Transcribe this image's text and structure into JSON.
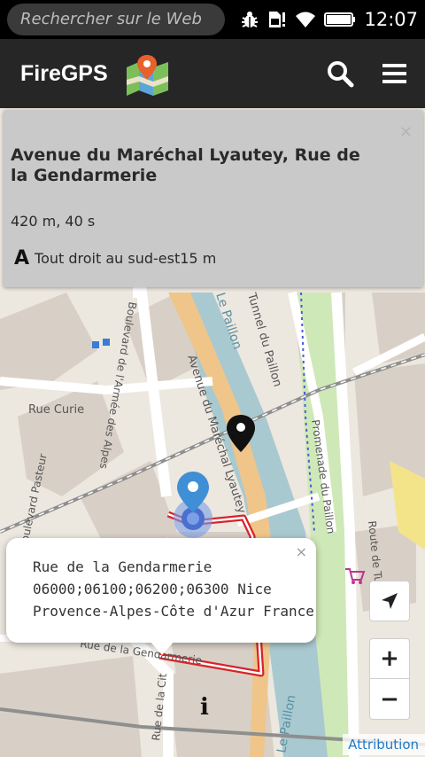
{
  "status_bar": {
    "search_placeholder": "Rechercher sur le Web",
    "time": "12:07",
    "icons": [
      "bug-icon",
      "sim-alert-icon",
      "wifi-icon",
      "battery-icon"
    ]
  },
  "app_bar": {
    "title": "FireGPS",
    "logo_icon": "map-pin-logo-icon",
    "search_icon": "search-icon",
    "menu_icon": "hamburger-menu-icon"
  },
  "route_panel": {
    "close": "×",
    "address": "Avenue du Maréchal Lyautey, Rue de la Gendarmerie",
    "summary": "420 m, 40 s",
    "step_icon": "A",
    "step": "Tout droit au sud-est15 m"
  },
  "map_labels": {
    "avenue_label": "Avenue du Maréchal Lyautey",
    "tunnel": "Tunnel du Paillon",
    "paillon_top": "Le Paillon",
    "promenade": "Promenade du Paillon",
    "route": "Route de Turin",
    "boulevard": "Boulevard de l'Armée des Alpes",
    "rue_curie": "Rue Curie",
    "pasteur": "Boulevard Pasteur",
    "gendarmerie_map": "Rue de la Gendarmerie",
    "rue_de_la_cit": "Rue de la Cit",
    "paillon_bottom": "Le Paillon",
    "info_marker": "i"
  },
  "popup": {
    "close": "×",
    "line1": "Rue de la Gendarmerie",
    "line2": "06000;06100;06200;06300 Nice",
    "line3": "Provence-Alpes-Côte d'Azur France"
  },
  "controls": {
    "locate_icon": "navigation-arrow-icon",
    "zoom_in": "+",
    "zoom_out": "−",
    "attribution": "Attribution"
  },
  "colors": {
    "status_bg": "#000000",
    "app_bar_bg": "#262626",
    "map_bg": "#ece7df",
    "river": "#a9c9d0",
    "avenue_road": "#f0c58a",
    "route_line": "#d8232a",
    "attribution_link": "#1e7ac6",
    "marker_blue": "#3f8fd6"
  }
}
